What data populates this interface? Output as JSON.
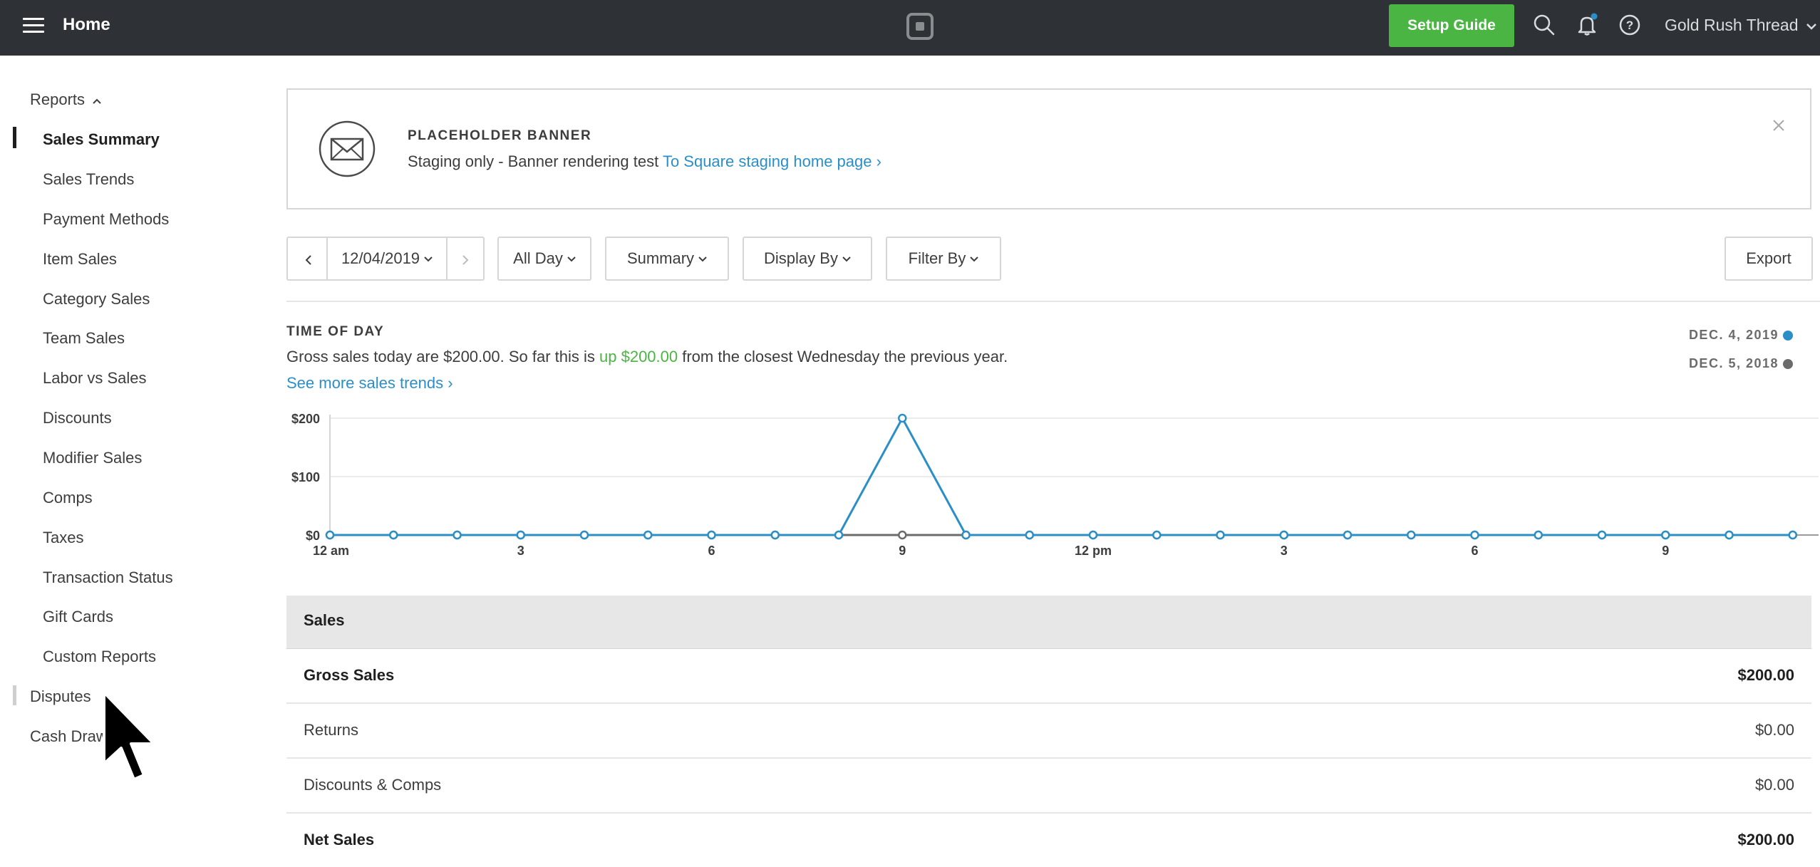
{
  "topbar": {
    "title": "Home",
    "setup_guide": "Setup Guide",
    "account_name": "Gold Rush Thread",
    "icons": [
      "menu-icon",
      "square-logo-icon",
      "search-icon",
      "bell-icon",
      "help-icon",
      "chevron-down-icon"
    ]
  },
  "sidebar": {
    "reports_label": "Reports",
    "items": [
      {
        "label": "Sales Summary",
        "active": true
      },
      {
        "label": "Sales Trends"
      },
      {
        "label": "Payment Methods"
      },
      {
        "label": "Item Sales"
      },
      {
        "label": "Category Sales"
      },
      {
        "label": "Team Sales"
      },
      {
        "label": "Labor vs Sales"
      },
      {
        "label": "Discounts"
      },
      {
        "label": "Modifier Sales"
      },
      {
        "label": "Comps"
      },
      {
        "label": "Taxes"
      },
      {
        "label": "Transaction Status"
      },
      {
        "label": "Gift Cards"
      },
      {
        "label": "Custom Reports"
      }
    ],
    "disputes_label": "Disputes",
    "cash_drawers_label": "Cash Draw"
  },
  "banner": {
    "title": "PLACEHOLDER BANNER",
    "text": "Staging only - Banner rendering test",
    "link": "To Square staging home page ›"
  },
  "toolbar": {
    "date": "12/04/2019",
    "range": "All Day",
    "view": "Summary",
    "display_by": "Display By",
    "filter_by": "Filter By",
    "export": "Export"
  },
  "time_of_day": {
    "title": "TIME OF DAY",
    "text_before": "Gross sales today are $200.00. So far this is ",
    "text_up": "up $200.00",
    "text_after": " from the closest Wednesday the previous year.",
    "link": "See more sales trends ›",
    "legend": [
      {
        "label": "DEC. 4, 2019",
        "color": "#2b8fc7"
      },
      {
        "label": "DEC. 5, 2018",
        "color": "#6b6b6b"
      }
    ]
  },
  "chart_data": {
    "type": "line",
    "x": [
      0,
      1,
      2,
      3,
      4,
      5,
      6,
      7,
      8,
      9,
      10,
      11,
      12,
      13,
      14,
      15,
      16,
      17,
      18,
      19,
      20,
      21,
      22,
      23
    ],
    "x_tick_labels": [
      {
        "x": 0,
        "label": "12 am"
      },
      {
        "x": 3,
        "label": "3"
      },
      {
        "x": 6,
        "label": "6"
      },
      {
        "x": 9,
        "label": "9"
      },
      {
        "x": 12,
        "label": "12 pm"
      },
      {
        "x": 15,
        "label": "3"
      },
      {
        "x": 18,
        "label": "6"
      },
      {
        "x": 21,
        "label": "9"
      }
    ],
    "y_ticks": [
      {
        "value": 0,
        "label": "$0"
      },
      {
        "value": 100,
        "label": "$100"
      },
      {
        "value": 200,
        "label": "$200"
      }
    ],
    "ylim": [
      0,
      200
    ],
    "series": [
      {
        "name": "DEC. 5, 2018",
        "color": "#6b6b6b",
        "values": [
          0,
          0,
          0,
          0,
          0,
          0,
          0,
          0,
          0,
          0,
          0,
          0,
          0,
          0,
          0,
          0,
          0,
          0,
          0,
          0,
          0,
          0,
          0,
          0
        ]
      },
      {
        "name": "DEC. 4, 2019",
        "color": "#2b8fc7",
        "values": [
          0,
          0,
          0,
          0,
          0,
          0,
          0,
          0,
          0,
          200,
          0,
          0,
          0,
          0,
          0,
          0,
          0,
          0,
          0,
          0,
          0,
          0,
          0,
          0
        ]
      }
    ],
    "grid": true
  },
  "sales_table": {
    "header": "Sales",
    "rows": [
      {
        "label": "Gross Sales",
        "value": "$200.00",
        "bold": true
      },
      {
        "label": "Returns",
        "value": "$0.00"
      },
      {
        "label": "Discounts & Comps",
        "value": "$0.00"
      },
      {
        "label": "Net Sales",
        "value": "$200.00",
        "bold": true
      }
    ]
  }
}
